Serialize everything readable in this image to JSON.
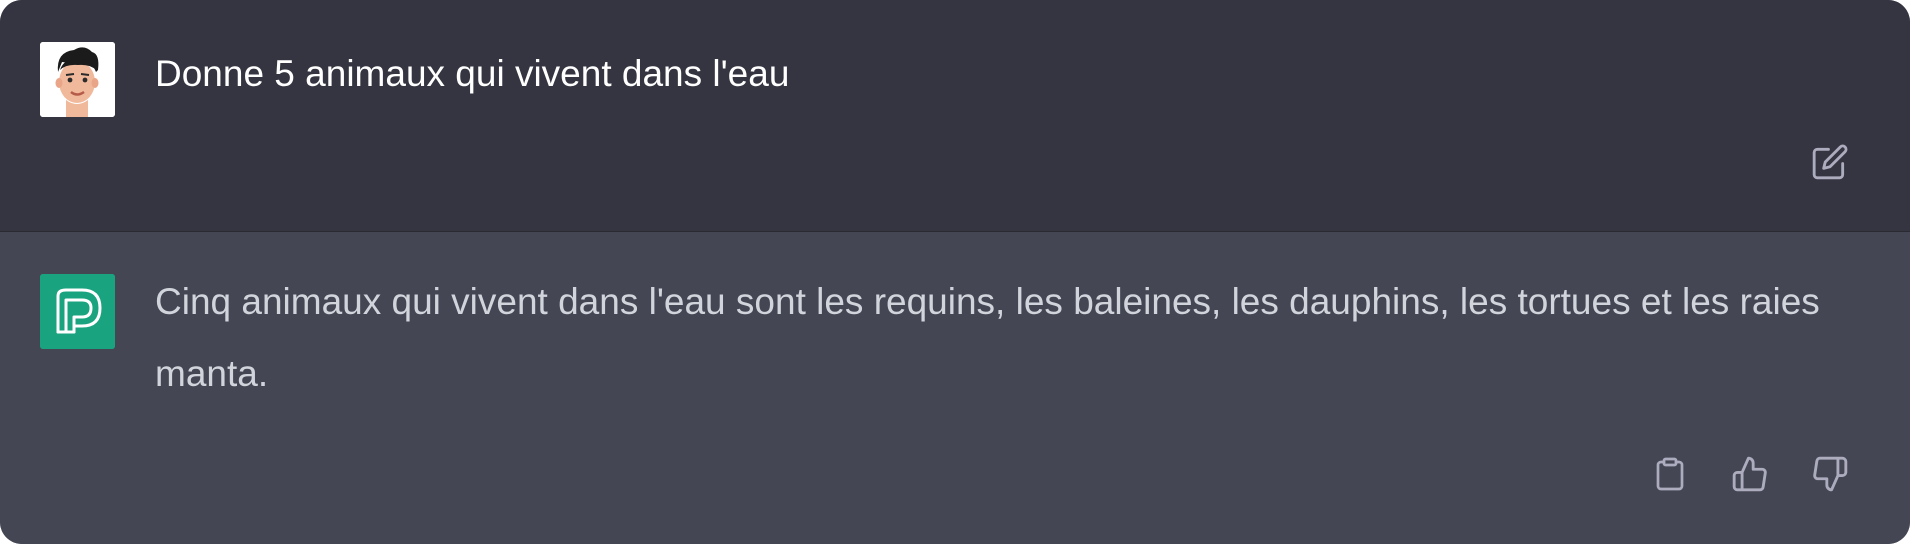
{
  "conversation": {
    "user_message": {
      "avatar_icon": "user-cartoon-avatar-icon",
      "text": "Donne 5 animaux qui vivent dans l'eau",
      "edit_icon": "edit-pencil-icon"
    },
    "assistant_message": {
      "avatar_icon": "assistant-logo-icon",
      "text": "Cinq animaux qui vivent dans l'eau sont les requins, les baleines, les dauphins, les tortues et les raies manta.",
      "copy_icon": "clipboard-icon",
      "thumbs_up_icon": "thumbs-up-icon",
      "thumbs_down_icon": "thumbs-down-icon"
    }
  },
  "colors": {
    "user_bg": "#343541",
    "assistant_bg": "#444654",
    "assistant_avatar_bg": "#19a37f",
    "text": "#ececf1",
    "icon": "#acacbe"
  }
}
